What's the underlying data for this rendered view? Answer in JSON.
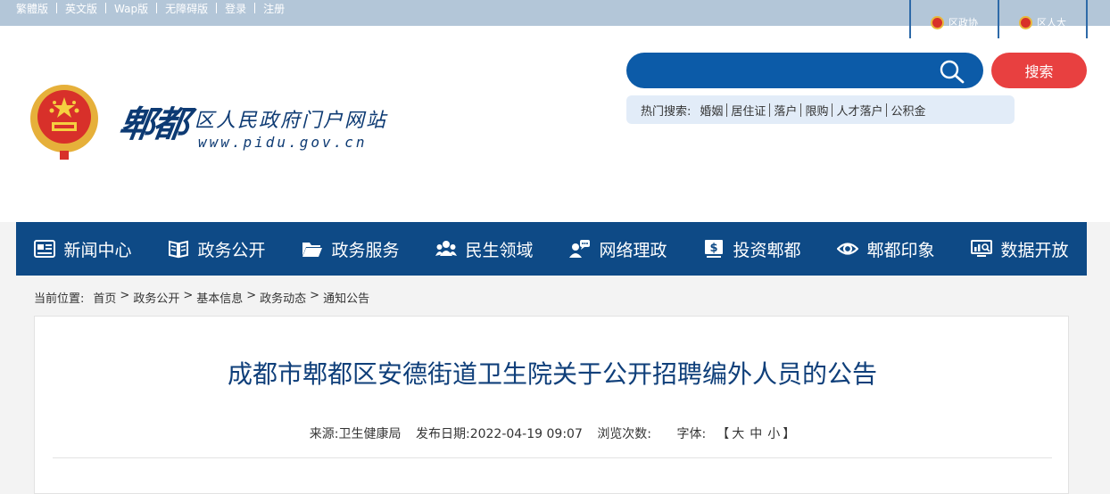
{
  "topbar": {
    "links": [
      "繁體版",
      "英文版",
      "Wap版",
      "无障碍版",
      "登录",
      "注册"
    ],
    "right_links": [
      "区政协",
      "区人大"
    ]
  },
  "header": {
    "logo_main": "郫都",
    "logo_sub": "区人民政府门户网站",
    "logo_url": "www.pidu.gov.cn"
  },
  "search": {
    "placeholder": "",
    "button_label": "搜索",
    "hot_label": "热门搜索:",
    "hot_keywords": [
      "婚姻",
      "居住证",
      "落户",
      "限购",
      "人才落户",
      "公积金"
    ]
  },
  "nav": {
    "items": [
      "新闻中心",
      "政务公开",
      "政务服务",
      "民生领域",
      "网络理政",
      "投资郫都",
      "郫都印象",
      "数据开放"
    ],
    "icons": [
      "news-icon",
      "book-icon",
      "folder-icon",
      "people-icon",
      "chat-user-icon",
      "dollar-icon",
      "eye-icon",
      "monitor-icon"
    ]
  },
  "breadcrumb": {
    "label": "当前位置:",
    "items": [
      "首页",
      "政务公开",
      "基本信息",
      "政务动态",
      "通知公告"
    ]
  },
  "article": {
    "title": "成都市郫都区安德街道卫生院关于公开招聘编外人员的公告",
    "source_label": "来源:",
    "source": "卫生健康局",
    "date_label": "发布日期:",
    "date": "2022-04-19 09:07",
    "views_label": "浏览次数:",
    "views": "",
    "font_label": "字体:",
    "font_open": "【",
    "font_large": "大",
    "font_medium": "中",
    "font_small": "小",
    "font_close": "】"
  },
  "colors": {
    "nav_bg": "#0e4a86",
    "search_bg": "#0c5ba8",
    "search_button": "#e84040",
    "title": "#0f3f7a",
    "topbar": "#b3c6d8"
  }
}
